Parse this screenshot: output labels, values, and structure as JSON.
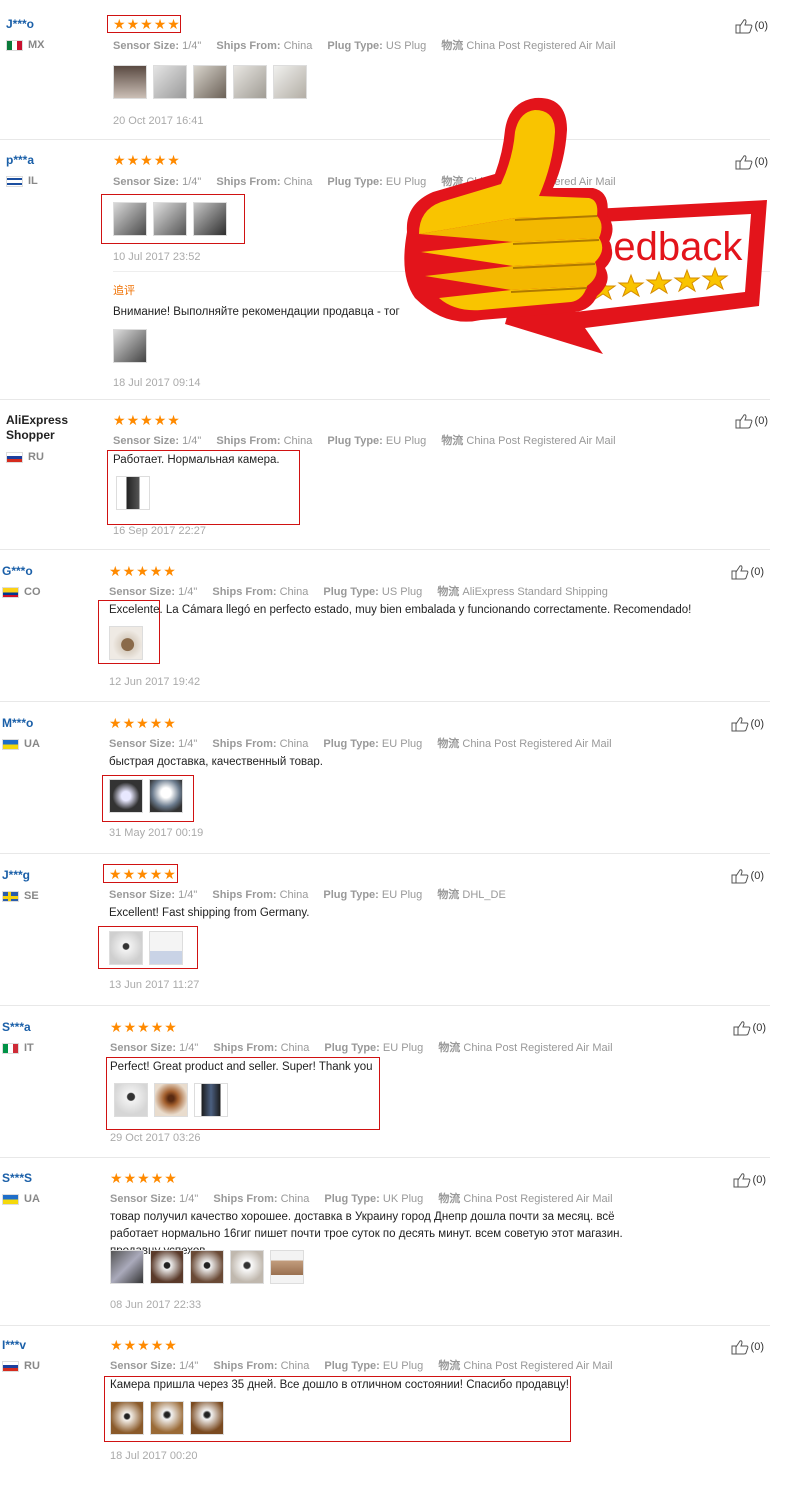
{
  "labels": {
    "sensor": "Sensor Size:",
    "ships": "Ships From:",
    "plug": "Plug Type:",
    "logistics": "物流"
  },
  "badge": {
    "text": "feedback"
  },
  "reviews": [
    {
      "user": "J***o",
      "country": "MX",
      "sensor": "1/4\"",
      "ships": "China",
      "plug": "US Plug",
      "logistics": "China Post Registered Air Mail",
      "comment": "",
      "date": "20 Oct 2017 16:41",
      "likes": "(0)"
    },
    {
      "user": "p***a",
      "country": "IL",
      "sensor": "1/4\"",
      "ships": "China",
      "plug": "EU Plug",
      "logistics": "China Post Registered Air Mail",
      "comment": "",
      "date": "10 Jul 2017 23:52",
      "likes": "(0)",
      "append": {
        "tag": "追评",
        "comment": "Внимание! Выполняйте рекомендации продавца - тог",
        "date": "18 Jul 2017 09:14"
      }
    },
    {
      "user": "AliExpress Shopper",
      "country": "RU",
      "sensor": "1/4\"",
      "ships": "China",
      "plug": "EU Plug",
      "logistics": "China Post Registered Air Mail",
      "comment": "Работает. Нормальная камера.",
      "date": "16 Sep 2017 22:27",
      "likes": "(0)"
    },
    {
      "user": "G***o",
      "country": "CO",
      "sensor": "1/4\"",
      "ships": "China",
      "plug": "US Plug",
      "logistics": "AliExpress Standard Shipping",
      "comment": "Excelente. La Cámara llegó en perfecto estado, muy bien embalada y funcionando correctamente. Recomendado!",
      "date": "12 Jun 2017 19:42",
      "likes": "(0)"
    },
    {
      "user": "M***o",
      "country": "UA",
      "sensor": "1/4\"",
      "ships": "China",
      "plug": "EU Plug",
      "logistics": "China Post Registered Air Mail",
      "comment": "быстрая доставка, качественный товар.",
      "date": "31 May 2017 00:19",
      "likes": "(0)"
    },
    {
      "user": "J***g",
      "country": "SE",
      "sensor": "1/4\"",
      "ships": "China",
      "plug": "EU Plug",
      "logistics": "DHL_DE",
      "comment": "Excellent! Fast shipping from Germany.",
      "date": "13 Jun 2017 11:27",
      "likes": "(0)"
    },
    {
      "user": "S***a",
      "country": "IT",
      "sensor": "1/4\"",
      "ships": "China",
      "plug": "EU Plug",
      "logistics": "China Post Registered Air Mail",
      "comment": "Perfect! Great product and seller. Super! Thank you",
      "date": "29 Oct 2017 03:26",
      "likes": "(0)"
    },
    {
      "user": "S***S",
      "country": "UA",
      "sensor": "1/4\"",
      "ships": "China",
      "plug": "UK Plug",
      "logistics": "China Post Registered Air Mail",
      "comment": "товар получил качество хорошее. доставка в Украину город Днепр дошла почти за месяц. всё работает нормально 16гиг пишет почти трое суток по десять минут. всем советую этот магазин. продавцу успехов",
      "date": "08 Jun 2017 22:33",
      "likes": "(0)"
    },
    {
      "user": "I***v",
      "country": "RU",
      "sensor": "1/4\"",
      "ships": "China",
      "plug": "EU Plug",
      "logistics": "China Post Registered Air Mail",
      "comment": "Камера пришла через 35 дней. Все дошло в отличном состоянии! Спасибо продавцу!",
      "date": "18 Jul 2017 00:20",
      "likes": "(0)"
    }
  ]
}
